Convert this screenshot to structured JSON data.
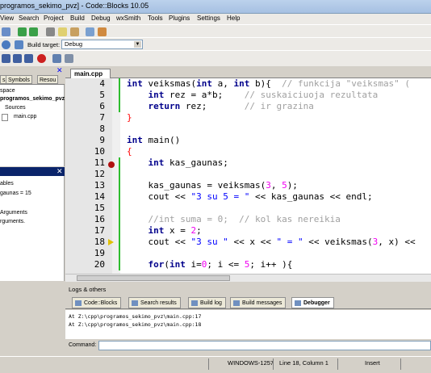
{
  "window": {
    "title": "programos_sekimo_pvz] - Code::Blocks 10.05"
  },
  "menu": [
    "View",
    "Search",
    "Project",
    "Build",
    "Debug",
    "wxSmith",
    "Tools",
    "Plugins",
    "Settings",
    "Help"
  ],
  "toolbar": {
    "build_target_label": "Build target:",
    "build_target_value": "Debug"
  },
  "management": {
    "tabs": [
      "s",
      "Symbols",
      "Resou"
    ],
    "tree": [
      "space",
      "programos_sekimo_pvz",
      "Sources",
      "main.cpp"
    ]
  },
  "watches": {
    "lines": [
      "ables",
      "gaunas = 15",
      "",
      "Arguments",
      "rguments."
    ]
  },
  "editor": {
    "tab": "main.cpp",
    "lines": [
      {
        "n": "4"
      },
      {
        "n": "5"
      },
      {
        "n": "6"
      },
      {
        "n": "7"
      },
      {
        "n": "8"
      },
      {
        "n": "9"
      },
      {
        "n": "10"
      },
      {
        "n": "11"
      },
      {
        "n": "12"
      },
      {
        "n": "13"
      },
      {
        "n": "14"
      },
      {
        "n": "15"
      },
      {
        "n": "16"
      },
      {
        "n": "17"
      },
      {
        "n": "18"
      },
      {
        "n": "19"
      },
      {
        "n": "20"
      }
    ]
  },
  "logs": {
    "title": "Logs & others",
    "tabs": [
      "Code::Blocks",
      "Search results",
      "Build log",
      "Build messages",
      "Debugger"
    ],
    "active_tab": "Debugger",
    "lines": [
      "At Z:\\cpp\\programos_sekimo_pvz\\main.cpp:17",
      "At Z:\\cpp\\programos_sekimo_pvz\\main.cpp:18"
    ],
    "command_label": "Command:"
  },
  "status": {
    "encoding": "WINDOWS-1257",
    "position": "Line 18, Column 1",
    "mode": "Insert"
  }
}
